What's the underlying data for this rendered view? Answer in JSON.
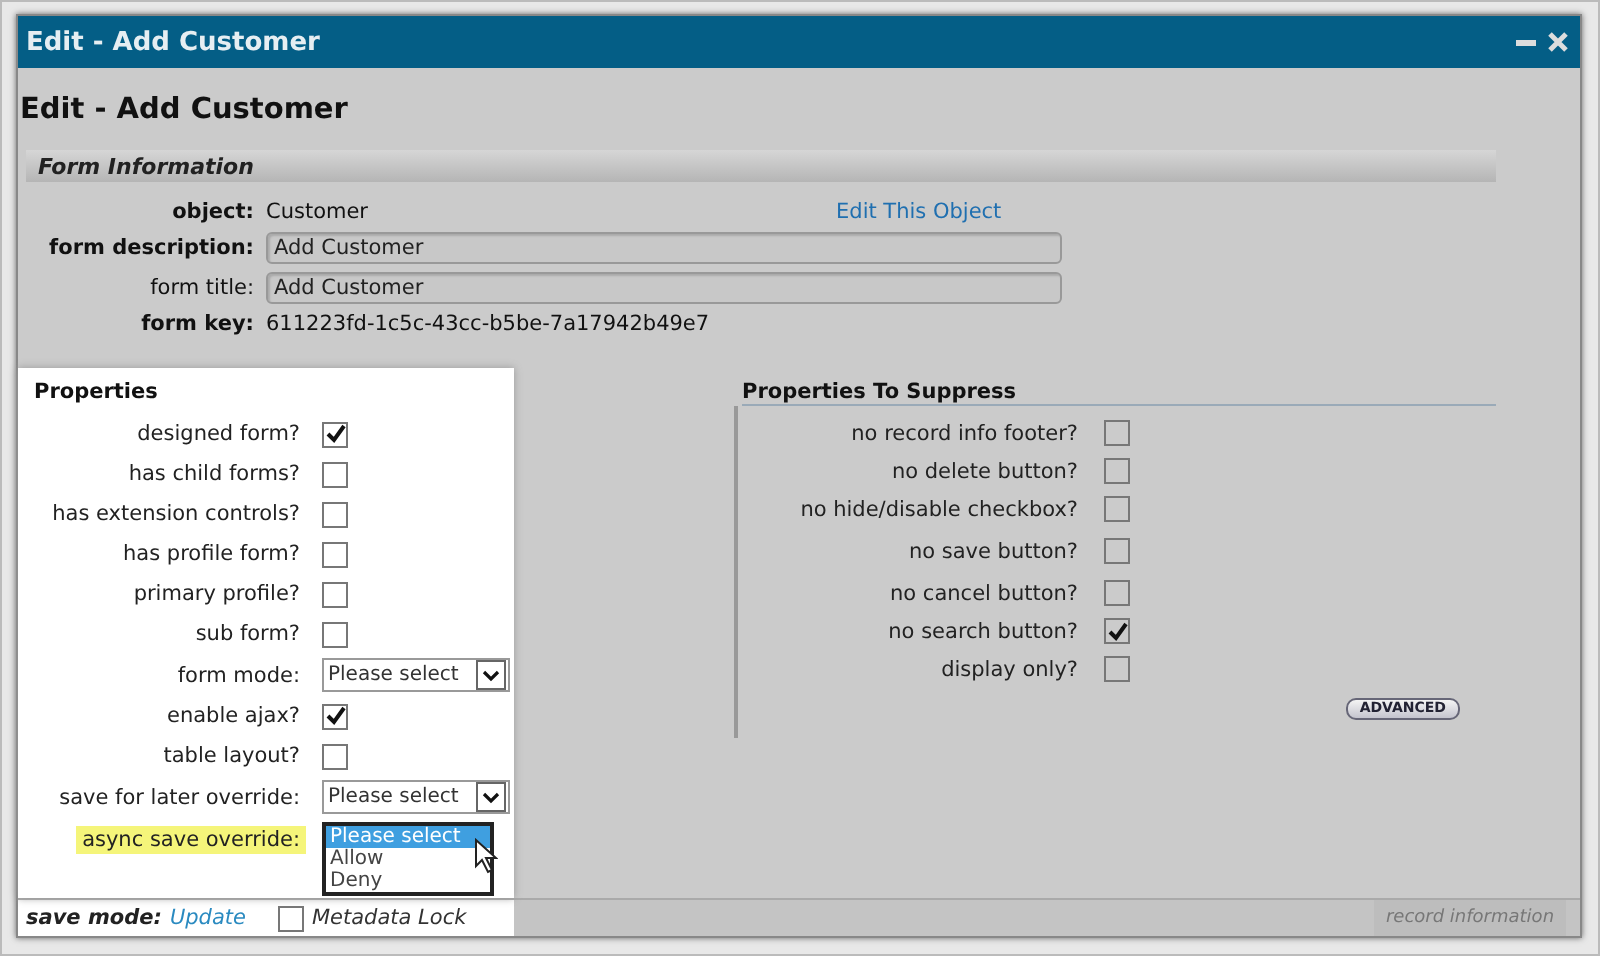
{
  "window": {
    "title": "Edit - Add Customer"
  },
  "heading": "Edit - Add Customer",
  "form_information": {
    "title": "Form Information",
    "fields": [
      {
        "kind": "text",
        "label": "object:",
        "emphasized": true,
        "value": "Customer",
        "link": "Edit This Object"
      },
      {
        "kind": "input",
        "label": "form description:",
        "emphasized": true,
        "value": "Add Customer"
      },
      {
        "kind": "input",
        "label": "form title:",
        "emphasized": false,
        "value": "Add Customer"
      },
      {
        "kind": "text",
        "label": "form key:",
        "emphasized": true,
        "value": "611223fd-1c5c-43cc-b5be-7a17942b49e7"
      }
    ]
  },
  "properties": {
    "title": "Properties",
    "rows": [
      {
        "kind": "checkbox",
        "label": "designed form?",
        "checked": true
      },
      {
        "kind": "checkbox",
        "label": "has child forms?",
        "checked": false
      },
      {
        "kind": "checkbox",
        "label": "has extension controls?",
        "checked": false
      },
      {
        "kind": "checkbox",
        "label": "has profile form?",
        "checked": false
      },
      {
        "kind": "checkbox",
        "label": "primary profile?",
        "checked": false
      },
      {
        "kind": "checkbox",
        "label": "sub form?",
        "checked": false
      },
      {
        "kind": "select",
        "label": "form mode:",
        "value": "Please select",
        "highlighted": false,
        "open": false
      },
      {
        "kind": "checkbox",
        "label": "enable ajax?",
        "checked": true
      },
      {
        "kind": "checkbox",
        "label": "table layout?",
        "checked": false
      },
      {
        "kind": "select",
        "label": "save for later override:",
        "value": "Please select",
        "highlighted": false,
        "open": false
      },
      {
        "kind": "select",
        "label": "async save override:",
        "highlighted": true,
        "open": true,
        "options": [
          {
            "label": "Please select",
            "selected": true
          },
          {
            "label": "Allow",
            "selected": false
          },
          {
            "label": "Deny",
            "selected": false
          }
        ]
      }
    ]
  },
  "suppress": {
    "title": "Properties To Suppress",
    "rows": [
      {
        "label": "no record info footer?",
        "checked": false
      },
      {
        "label": "no delete button?",
        "checked": false
      },
      {
        "label": "no hide/disable checkbox?",
        "checked": false
      },
      {
        "label": "no save button?",
        "checked": false
      },
      {
        "label": "no cancel button?",
        "checked": false
      },
      {
        "label": "no search button?",
        "checked": true
      },
      {
        "label": "display only?",
        "checked": false
      }
    ],
    "button": "ADVANCED"
  },
  "footer": {
    "label": "save mode:",
    "value": "Update",
    "lock": {
      "label": "Metadata Lock",
      "checked": false
    },
    "record_info": "record information"
  }
}
